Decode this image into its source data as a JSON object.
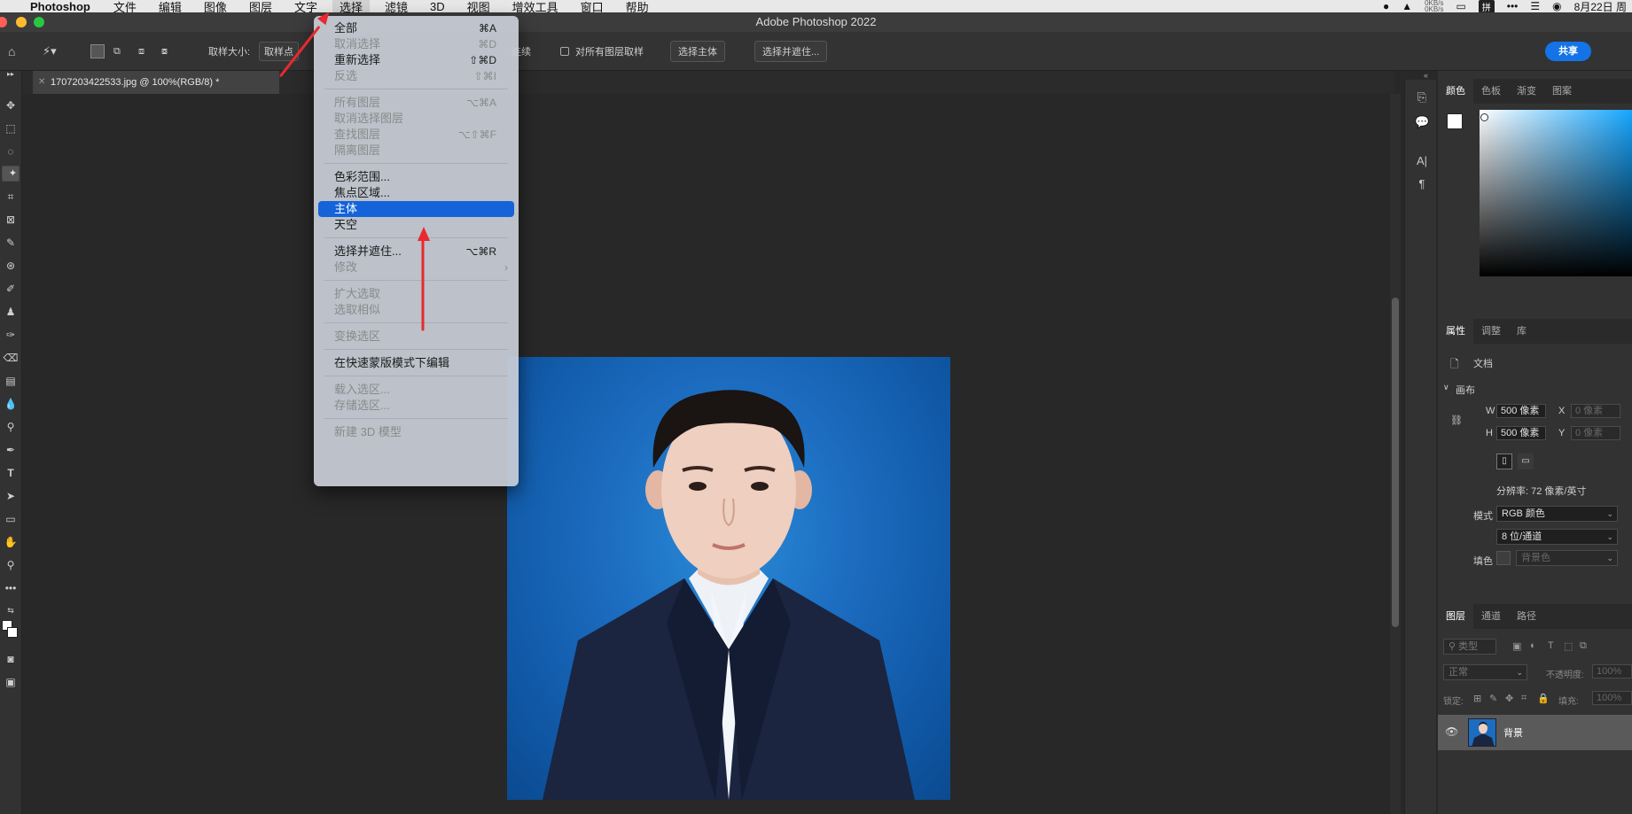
{
  "menubar": {
    "app_name": "Photoshop",
    "items": [
      "文件",
      "编辑",
      "图像",
      "图层",
      "文字",
      "选择",
      "滤镜",
      "3D",
      "视图",
      "增效工具",
      "窗口",
      "帮助"
    ],
    "active_index": 5,
    "status": {
      "net_up": "0KB/s",
      "net_down": "0KB/s",
      "input_method": "拼",
      "date": "8月22日 周"
    }
  },
  "window": {
    "title": "Adobe Photoshop 2022"
  },
  "options_bar": {
    "sample_size_label": "取样大小:",
    "sample_size_value": "取样点",
    "contiguous_label": "连续",
    "sample_all_layers_label": "对所有图层取样",
    "select_subject_button": "选择主体",
    "select_and_mask_button": "选择并遮住...",
    "share_button": "共享"
  },
  "document": {
    "tab_title": "1707203422533.jpg @ 100%(RGB/8) *"
  },
  "select_menu": {
    "groups": [
      [
        {
          "label": "全部",
          "shortcut": "⌘A",
          "enabled": true
        },
        {
          "label": "取消选择",
          "shortcut": "⌘D",
          "enabled": false
        },
        {
          "label": "重新选择",
          "shortcut": "⇧⌘D",
          "enabled": true
        },
        {
          "label": "反选",
          "shortcut": "⇧⌘I",
          "enabled": false
        }
      ],
      [
        {
          "label": "所有图层",
          "shortcut": "⌥⌘A",
          "enabled": false
        },
        {
          "label": "取消选择图层",
          "shortcut": "",
          "enabled": false
        },
        {
          "label": "查找图层",
          "shortcut": "⌥⇧⌘F",
          "enabled": false
        },
        {
          "label": "隔离图层",
          "shortcut": "",
          "enabled": false
        }
      ],
      [
        {
          "label": "色彩范围...",
          "shortcut": "",
          "enabled": true
        },
        {
          "label": "焦点区域...",
          "shortcut": "",
          "enabled": true
        },
        {
          "label": "主体",
          "shortcut": "",
          "enabled": true,
          "highlighted": true
        },
        {
          "label": "天空",
          "shortcut": "",
          "enabled": true
        }
      ],
      [
        {
          "label": "选择并遮住...",
          "shortcut": "⌥⌘R",
          "enabled": true
        },
        {
          "label": "修改",
          "shortcut": "›",
          "enabled": false
        }
      ],
      [
        {
          "label": "扩大选取",
          "shortcut": "",
          "enabled": false
        },
        {
          "label": "选取相似",
          "shortcut": "",
          "enabled": false
        }
      ],
      [
        {
          "label": "变换选区",
          "shortcut": "",
          "enabled": false
        }
      ],
      [
        {
          "label": "在快速蒙版模式下编辑",
          "shortcut": "",
          "enabled": true
        }
      ],
      [
        {
          "label": "载入选区...",
          "shortcut": "",
          "enabled": false
        },
        {
          "label": "存储选区...",
          "shortcut": "",
          "enabled": false
        }
      ],
      [
        {
          "label": "新建 3D 模型",
          "shortcut": "",
          "enabled": false
        }
      ]
    ]
  },
  "color_panel": {
    "tabs": [
      "颜色",
      "色板",
      "渐变",
      "图案"
    ],
    "active": 0
  },
  "properties_panel": {
    "tabs": [
      "属性",
      "调整",
      "库"
    ],
    "active": 0,
    "doc_label": "文档",
    "canvas_section": "画布",
    "w_label": "W",
    "w_value": "500 像素",
    "h_label": "H",
    "h_value": "500 像素",
    "x_label": "X",
    "x_placeholder": "0 像素",
    "y_label": "Y",
    "y_placeholder": "0 像素",
    "resolution": "分辨率: 72 像素/英寸",
    "mode_label": "模式",
    "mode_value": "RGB 颜色",
    "depth_value": "8 位/通道",
    "fill_label": "填色",
    "fill_value": "背景色"
  },
  "layers_panel": {
    "tabs": [
      "图层",
      "通道",
      "路径"
    ],
    "active": 0,
    "filter_label": "类型",
    "blend_mode": "正常",
    "opacity_label": "不透明度:",
    "opacity_value": "100%",
    "lock_label": "锁定:",
    "fill_label": "填充:",
    "fill_value": "100%",
    "layers": [
      {
        "name": "背景",
        "visible": true
      }
    ]
  },
  "colors": {
    "highlight": "#1463d9",
    "share": "#1473e6",
    "annotation_arrow": "#e8292f",
    "photo_bg": "#1c6cc0"
  }
}
